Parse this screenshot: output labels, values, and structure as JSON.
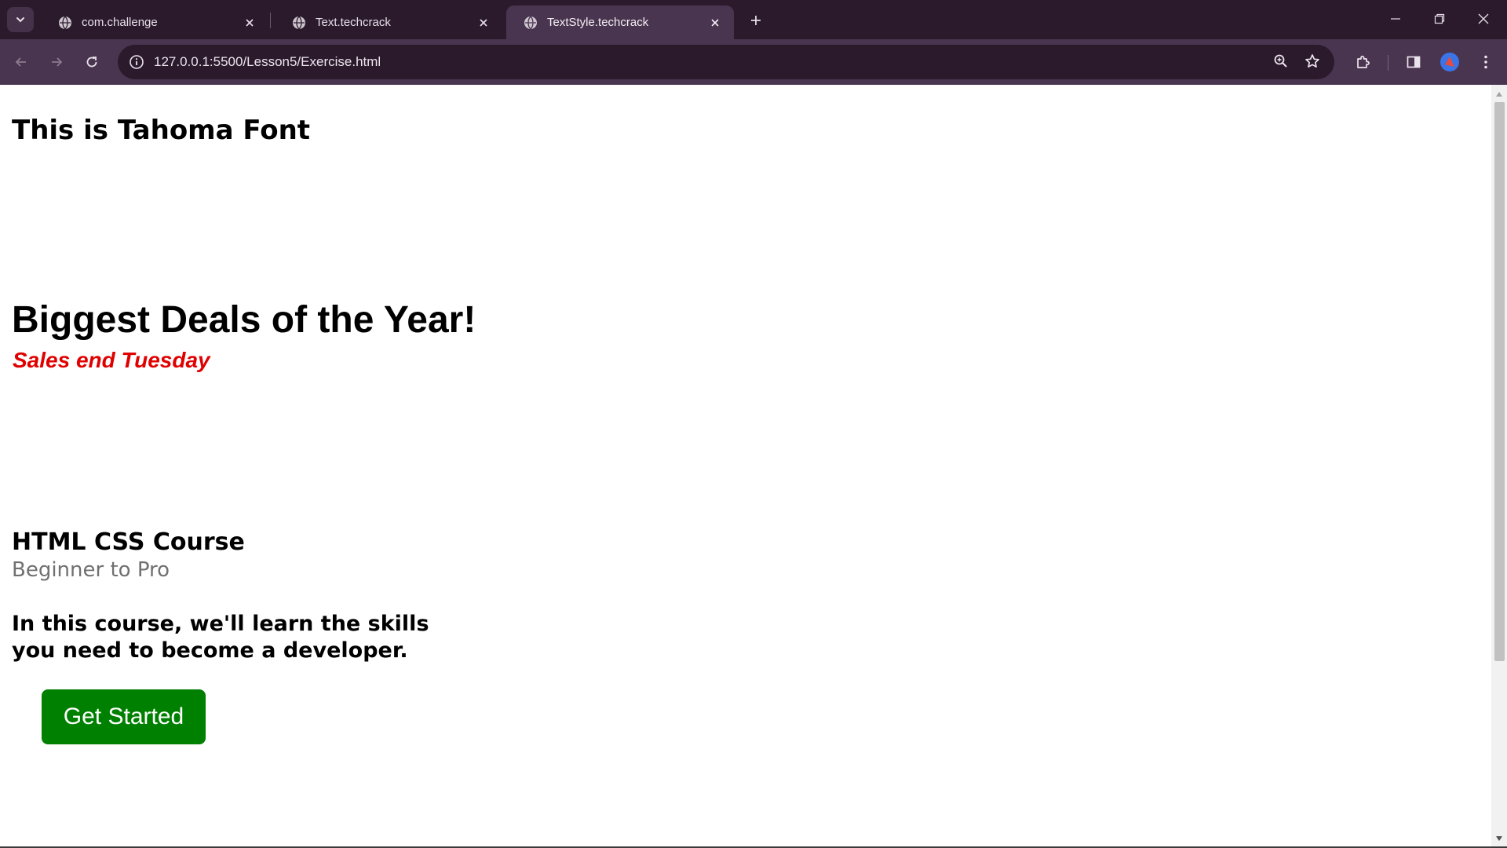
{
  "browser": {
    "tabs": [
      {
        "title": "com.challenge",
        "active": false
      },
      {
        "title": "Text.techcrack",
        "active": false
      },
      {
        "title": "TextStyle.techcrack",
        "active": true
      }
    ],
    "address": "127.0.0.1:5500/Lesson5/Exercise.html",
    "colors": {
      "frame": "#2b1a2c",
      "toolbar": "#4a3550"
    }
  },
  "page": {
    "heading_tahoma": "This is Tahoma Font",
    "heading_deals": "Biggest Deals of the Year!",
    "sales_note": "Sales end Tuesday",
    "course_title": "HTML CSS Course",
    "course_subtitle": "Beginner to Pro",
    "course_description": "In this course, we'll learn the skills you need to become a developer.",
    "cta_label": "Get Started",
    "colors": {
      "sales": "#e00000",
      "cta": "#008000",
      "subtitle": "#707070"
    }
  }
}
